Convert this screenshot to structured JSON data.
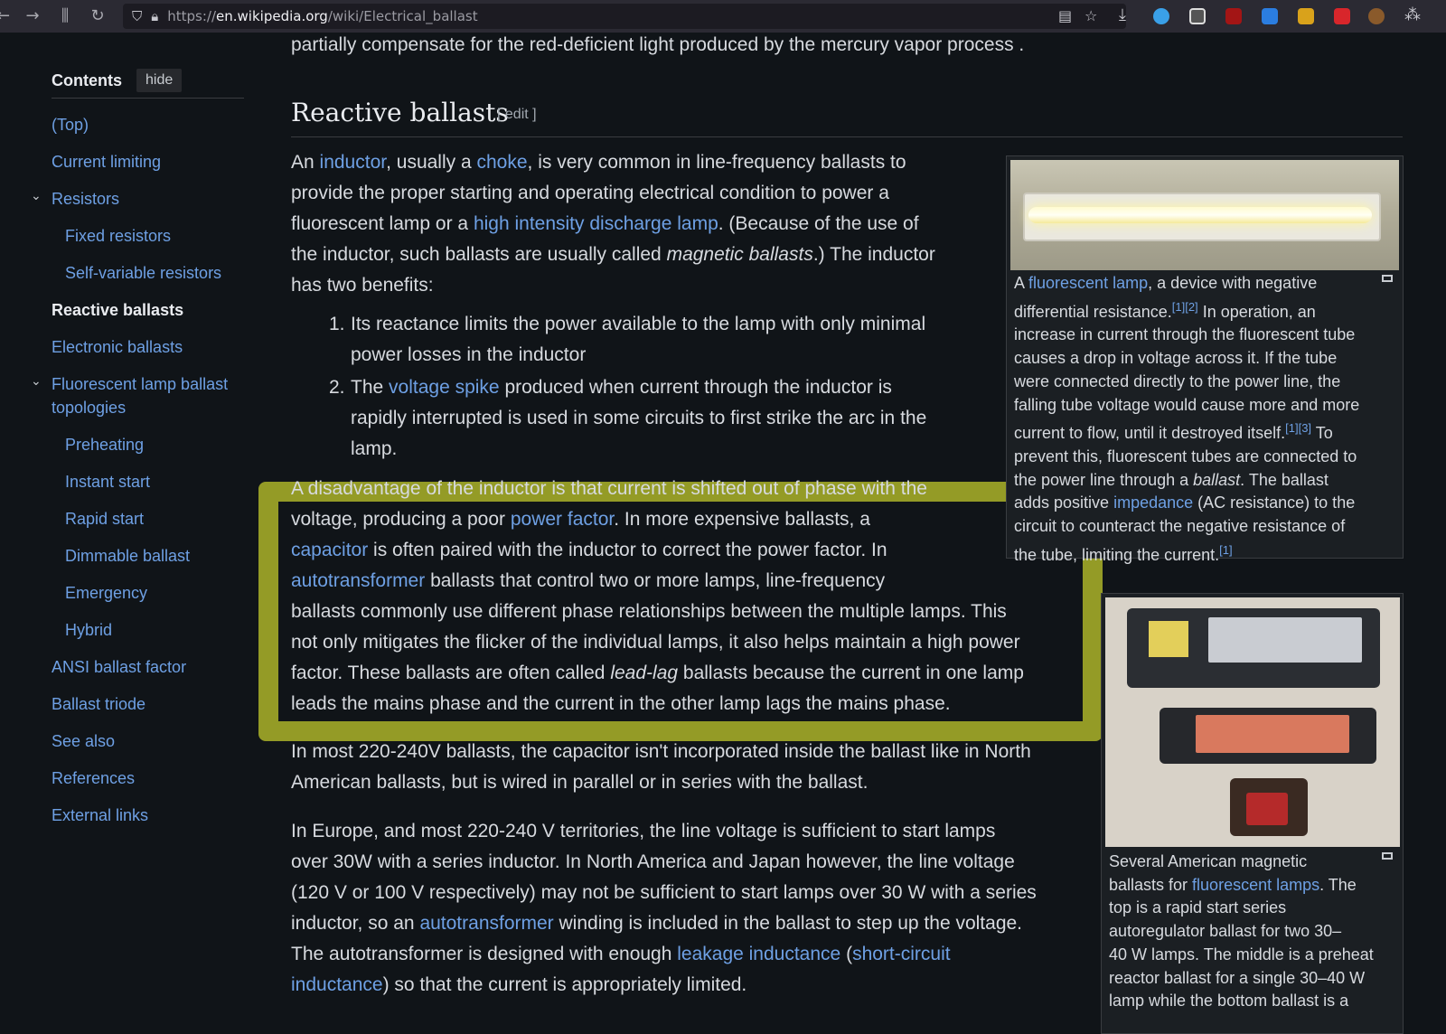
{
  "browser": {
    "url_scheme": "https://",
    "url_host": "en.wikipedia.org",
    "url_path": "/wiki/Electrical_ballast"
  },
  "toc": {
    "title": "Contents",
    "hide_label": "hide",
    "items": [
      {
        "label": "(Top)"
      },
      {
        "label": "Current limiting"
      },
      {
        "label": "Resistors"
      },
      {
        "label": "Fixed resistors"
      },
      {
        "label": "Self-variable resistors"
      },
      {
        "label": "Reactive ballasts"
      },
      {
        "label": "Electronic ballasts"
      },
      {
        "label": "Fluorescent lamp ballast"
      },
      {
        "label": "topologies"
      },
      {
        "label": "Preheating"
      },
      {
        "label": "Instant start"
      },
      {
        "label": "Rapid start"
      },
      {
        "label": "Dimmable ballast"
      },
      {
        "label": "Emergency"
      },
      {
        "label": "Hybrid"
      },
      {
        "label": "ANSI ballast factor"
      },
      {
        "label": "Ballast triode"
      },
      {
        "label": "See also"
      },
      {
        "label": "References"
      },
      {
        "label": "External links"
      }
    ]
  },
  "article": {
    "top_line": "partially compensate for the red-deficient light produced by the mercury vapor process .",
    "heading": "Reactive ballasts",
    "edit_label": "[ edit ]",
    "p1": {
      "l1a": "An ",
      "l1b": "inductor",
      "l1c": ", usually a ",
      "l1d": "choke",
      "l1e": ", is very common in line-frequency ballasts to",
      "l2": "provide the proper starting and operating electrical condition to power a",
      "l3a": "fluorescent lamp or a ",
      "l3b": "high intensity discharge lamp",
      "l3c": ". (Because of the use of",
      "l4a": "the inductor, such ballasts are usually called ",
      "l4b": "magnetic ballasts",
      "l4c": ".) The inductor",
      "l5": "has two benefits:"
    },
    "list": {
      "n1": "1.",
      "i1l1": "Its reactance limits the power available to the lamp with only minimal",
      "i1l2": "power losses in the inductor",
      "n2": "2.",
      "i2l1a": "The ",
      "i2l1b": "voltage spike",
      "i2l1c": " produced when current through the inductor is",
      "i2l2": "rapidly interrupted is used in some circuits to first strike the arc in the",
      "i2l3": "lamp."
    },
    "p2": {
      "l1": "A disadvantage of the inductor is that current is shifted out of phase with the",
      "l2a": "voltage, producing a poor ",
      "l2b": "power factor",
      "l2c": ". In more expensive ballasts, a",
      "l3a": "capacitor",
      "l3b": " is often paired with the inductor to correct the power factor. In",
      "l4a": "autotransformer",
      "l4b": " ballasts that control two or more lamps, line-frequency",
      "l5": "ballasts commonly use different phase relationships between the multiple lamps. This",
      "l6": "not only mitigates the flicker of the individual lamps, it also helps maintain a high power",
      "l7a": "factor. These ballasts are often called ",
      "l7b": "lead-lag",
      "l7c": " ballasts because the current in one lamp",
      "l8": "leads the mains phase and the current in the other lamp lags the mains phase."
    },
    "p3": {
      "l1": "In most 220-240V ballasts, the capacitor isn't incorporated inside the ballast like in North",
      "l2": "American ballasts, but is wired in parallel or in series with the ballast."
    },
    "p4": {
      "l1": "In Europe, and most 220-240 V territories, the line voltage is sufficient to start lamps",
      "l2": "over 30W with a series inductor. In North America and Japan however, the line voltage",
      "l3": "(120 V or 100 V respectively) may not be sufficient to start lamps over 30 W with a series",
      "l4a": "inductor, so an ",
      "l4b": "autotransformer",
      "l4c": " winding is included in the ballast to step up the voltage.",
      "l5a": "The autotransformer is designed with enough ",
      "l5b": "leakage inductance",
      "l5c": " (",
      "l5d": "short-circuit",
      "l6a": "inductance",
      "l6b": ") so that the current is appropriately limited."
    }
  },
  "thumb1": {
    "cap": {
      "l1a": "A ",
      "l1b": "fluorescent lamp",
      "l1c": ", a device with negative",
      "l2a": "differential resistance.",
      "l2b": "[1][2]",
      "l2c": " In operation, an",
      "l3": "increase in current through the fluorescent tube",
      "l4": "causes a drop in voltage across it. If the tube",
      "l5": "were connected directly to the power line, the",
      "l6": "falling tube voltage would cause more and more",
      "l7a": "current to flow, until it destroyed itself.",
      "l7b": "[1][3]",
      "l7c": " To",
      "l8": "prevent this, fluorescent tubes are connected to",
      "l9a": "the power line through a ",
      "l9b": "ballast",
      "l9c": ". The ballast",
      "l10a": "adds positive ",
      "l10b": "impedance",
      "l10c": " (AC resistance) to the",
      "l11": "circuit to counteract the negative resistance of",
      "l12a": "the tube, limiting the current.",
      "l12b": "[1]"
    }
  },
  "thumb2": {
    "cap": {
      "l1": "Several American magnetic",
      "l2a": "ballasts for ",
      "l2b": "fluorescent lamps",
      "l2c": ". The",
      "l3": "top is a rapid start series",
      "l4": "autoregulator ballast for two 30–",
      "l5": "40 W lamps. The middle is a preheat",
      "l6": "reactor ballast for a single 30–40 W",
      "l7": "lamp while the bottom ballast is a"
    }
  }
}
